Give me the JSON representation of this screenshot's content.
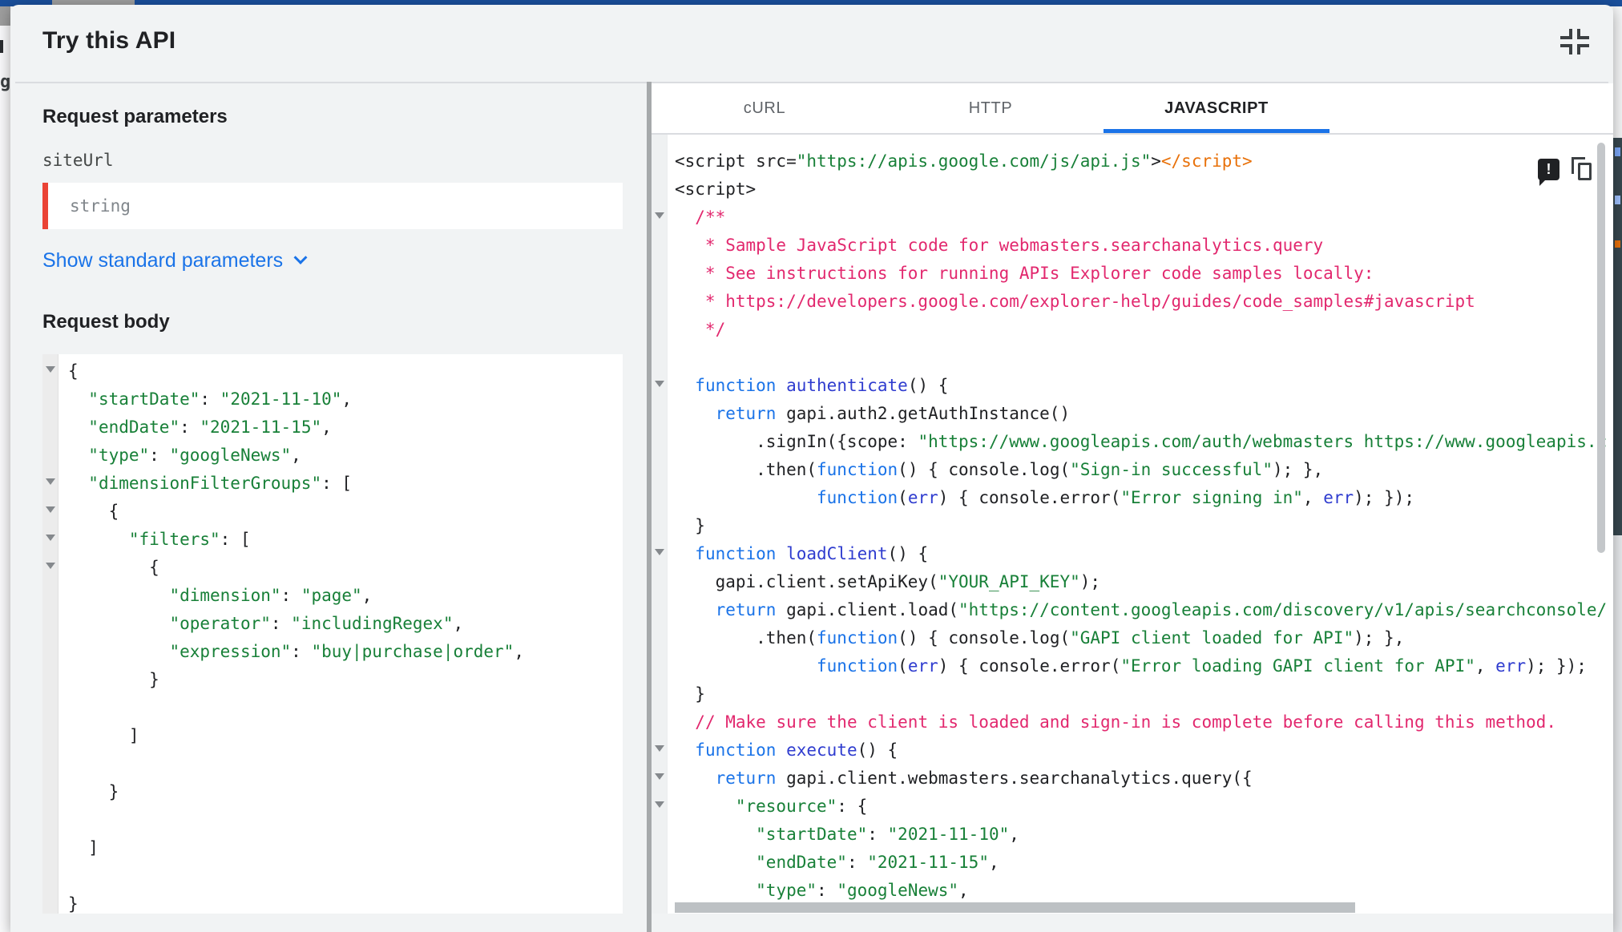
{
  "header": {
    "title": "Try this API"
  },
  "request_parameters": {
    "heading": "Request parameters",
    "site_url_label": "siteUrl",
    "site_url_placeholder": "string",
    "show_standard_parameters_label": "Show standard parameters"
  },
  "request_body": {
    "heading": "Request body",
    "fold_lines": [
      1,
      5,
      6,
      7,
      8
    ],
    "lines": [
      [
        [
          "{",
          "p"
        ]
      ],
      [
        [
          "  ",
          "p"
        ],
        [
          "\"startDate\"",
          "g"
        ],
        [
          ": ",
          "p"
        ],
        [
          "\"2021-11-10\"",
          "g"
        ],
        [
          ",",
          "p"
        ]
      ],
      [
        [
          "  ",
          "p"
        ],
        [
          "\"endDate\"",
          "g"
        ],
        [
          ": ",
          "p"
        ],
        [
          "\"2021-11-15\"",
          "g"
        ],
        [
          ",",
          "p"
        ]
      ],
      [
        [
          "  ",
          "p"
        ],
        [
          "\"type\"",
          "g"
        ],
        [
          ": ",
          "p"
        ],
        [
          "\"googleNews\"",
          "g"
        ],
        [
          ",",
          "p"
        ]
      ],
      [
        [
          "  ",
          "p"
        ],
        [
          "\"dimensionFilterGroups\"",
          "g"
        ],
        [
          ": [",
          "p"
        ]
      ],
      [
        [
          "    {",
          "p"
        ]
      ],
      [
        [
          "      ",
          "p"
        ],
        [
          "\"filters\"",
          "g"
        ],
        [
          ": [",
          "p"
        ]
      ],
      [
        [
          "        {",
          "p"
        ]
      ],
      [
        [
          "          ",
          "p"
        ],
        [
          "\"dimension\"",
          "g"
        ],
        [
          ": ",
          "p"
        ],
        [
          "\"page\"",
          "g"
        ],
        [
          ",",
          "p"
        ]
      ],
      [
        [
          "          ",
          "p"
        ],
        [
          "\"operator\"",
          "g"
        ],
        [
          ": ",
          "p"
        ],
        [
          "\"includingRegex\"",
          "g"
        ],
        [
          ",",
          "p"
        ]
      ],
      [
        [
          "          ",
          "p"
        ],
        [
          "\"expression\"",
          "g"
        ],
        [
          ": ",
          "p"
        ],
        [
          "\"buy|purchase|order\"",
          "g"
        ],
        [
          ",",
          "p"
        ]
      ],
      [
        [
          "        }",
          "p"
        ]
      ],
      [],
      [
        [
          "      ]",
          "p"
        ]
      ],
      [],
      [
        [
          "    }",
          "p"
        ]
      ],
      [],
      [
        [
          "  ]",
          "p"
        ]
      ],
      [],
      [
        [
          "}",
          "p"
        ]
      ]
    ]
  },
  "code_sample": {
    "tabs": [
      {
        "label": "cURL",
        "active": false
      },
      {
        "label": "HTTP",
        "active": false
      },
      {
        "label": "JAVASCRIPT",
        "active": true
      }
    ],
    "fold_lines": [
      3,
      9,
      15,
      22,
      23,
      24
    ],
    "lines": [
      [
        [
          "<script src=",
          "p"
        ],
        [
          "\"https://apis.google.com/js/api.js\"",
          "g"
        ],
        [
          ">",
          "p"
        ],
        [
          "</script>",
          "o"
        ]
      ],
      [
        [
          "<script>",
          "p"
        ]
      ],
      [
        [
          "  ",
          "p"
        ],
        [
          "/**",
          "c"
        ]
      ],
      [
        [
          "   * Sample JavaScript code for webmasters.searchanalytics.query",
          "c"
        ]
      ],
      [
        [
          "   * See instructions for running APIs Explorer code samples locally:",
          "c"
        ]
      ],
      [
        [
          "   * https://developers.google.com/explorer-help/guides/code_samples#javascript",
          "c"
        ]
      ],
      [
        [
          "   */",
          "c"
        ]
      ],
      [],
      [
        [
          "  ",
          "p"
        ],
        [
          "function",
          "k"
        ],
        [
          " ",
          "p"
        ],
        [
          "authenticate",
          "d"
        ],
        [
          "() {",
          "p"
        ]
      ],
      [
        [
          "    ",
          "p"
        ],
        [
          "return",
          "k"
        ],
        [
          " gapi.auth2.getAuthInstance()",
          "p"
        ]
      ],
      [
        [
          "        .signIn({scope: ",
          "p"
        ],
        [
          "\"https://www.googleapis.com/auth/webmasters https://www.googleapis.c",
          "g"
        ]
      ],
      [
        [
          "        .then(",
          "p"
        ],
        [
          "function",
          "k"
        ],
        [
          "() { console.log(",
          "p"
        ],
        [
          "\"Sign-in successful\"",
          "g"
        ],
        [
          "); },",
          "p"
        ]
      ],
      [
        [
          "              ",
          "p"
        ],
        [
          "function",
          "k"
        ],
        [
          "(",
          "p"
        ],
        [
          "err",
          "d"
        ],
        [
          ") { console.error(",
          "p"
        ],
        [
          "\"Error signing in\"",
          "g"
        ],
        [
          ", ",
          "p"
        ],
        [
          "err",
          "d"
        ],
        [
          "); });",
          "p"
        ]
      ],
      [
        [
          "  }",
          "p"
        ]
      ],
      [
        [
          "  ",
          "p"
        ],
        [
          "function",
          "k"
        ],
        [
          " ",
          "p"
        ],
        [
          "loadClient",
          "d"
        ],
        [
          "() {",
          "p"
        ]
      ],
      [
        [
          "    gapi.client.setApiKey(",
          "p"
        ],
        [
          "\"YOUR_API_KEY\"",
          "g"
        ],
        [
          ");",
          "p"
        ]
      ],
      [
        [
          "    ",
          "p"
        ],
        [
          "return",
          "k"
        ],
        [
          " gapi.client.load(",
          "p"
        ],
        [
          "\"https://content.googleapis.com/discovery/v1/apis/searchconsole/",
          "g"
        ]
      ],
      [
        [
          "        .then(",
          "p"
        ],
        [
          "function",
          "k"
        ],
        [
          "() { console.log(",
          "p"
        ],
        [
          "\"GAPI client loaded for API\"",
          "g"
        ],
        [
          "); },",
          "p"
        ]
      ],
      [
        [
          "              ",
          "p"
        ],
        [
          "function",
          "k"
        ],
        [
          "(",
          "p"
        ],
        [
          "err",
          "d"
        ],
        [
          ") { console.error(",
          "p"
        ],
        [
          "\"Error loading GAPI client for API\"",
          "g"
        ],
        [
          ", ",
          "p"
        ],
        [
          "err",
          "d"
        ],
        [
          "); });",
          "p"
        ]
      ],
      [
        [
          "  }",
          "p"
        ]
      ],
      [
        [
          "  ",
          "p"
        ],
        [
          "// Make sure the client is loaded and sign-in is complete before calling this method.",
          "c"
        ]
      ],
      [
        [
          "  ",
          "p"
        ],
        [
          "function",
          "k"
        ],
        [
          " ",
          "p"
        ],
        [
          "execute",
          "d"
        ],
        [
          "() {",
          "p"
        ]
      ],
      [
        [
          "    ",
          "p"
        ],
        [
          "return",
          "k"
        ],
        [
          " gapi.client.webmasters.searchanalytics.query({",
          "p"
        ]
      ],
      [
        [
          "      ",
          "p"
        ],
        [
          "\"resource\"",
          "g"
        ],
        [
          ": {",
          "p"
        ]
      ],
      [
        [
          "        ",
          "p"
        ],
        [
          "\"startDate\"",
          "g"
        ],
        [
          ": ",
          "p"
        ],
        [
          "\"2021-11-10\"",
          "g"
        ],
        [
          ",",
          "p"
        ]
      ],
      [
        [
          "        ",
          "p"
        ],
        [
          "\"endDate\"",
          "g"
        ],
        [
          ": ",
          "p"
        ],
        [
          "\"2021-11-15\"",
          "g"
        ],
        [
          ",",
          "p"
        ]
      ],
      [
        [
          "        ",
          "p"
        ],
        [
          "\"type\"",
          "g"
        ],
        [
          ": ",
          "p"
        ],
        [
          "\"googleNews\"",
          "g"
        ],
        [
          ",",
          "p"
        ]
      ]
    ]
  },
  "icons": {
    "header_icon": "fullscreen-exit",
    "code_panel_icons": [
      "report-issue",
      "copy"
    ]
  },
  "background_artifacts": {
    "left_edge_text": "g"
  },
  "colors": {
    "accent": "#1a73e8",
    "keyword": "#1a73e8",
    "ident": "#2f3ccf",
    "string": "#188038",
    "comment": "#e2286e",
    "tagclose": "#e8710a",
    "plain": "#202124",
    "topbar": "#1a4f9b",
    "error_red": "#ea4335",
    "divider": "#dadce0",
    "panel_bg": "#f1f3f4",
    "icon_ink": "#3c4043"
  }
}
